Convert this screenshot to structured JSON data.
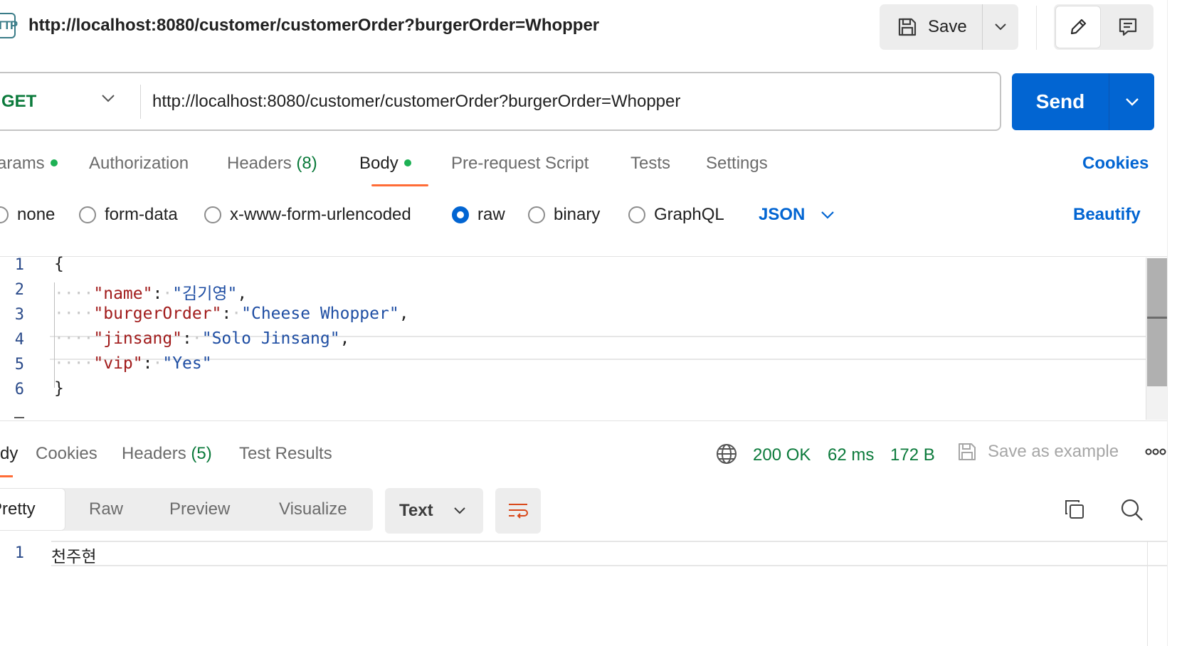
{
  "title_bar": {
    "icon_text": "HTTP",
    "request_title": "http://localhost:8080/customer/customerOrder?burgerOrder=Whopper",
    "save_label": "Save"
  },
  "request": {
    "method": "GET",
    "url": "http://localhost:8080/customer/customerOrder?burgerOrder=Whopper",
    "send_label": "Send"
  },
  "request_tabs": {
    "params": "arams",
    "authorization": "Authorization",
    "headers": "Headers",
    "headers_count": "(8)",
    "body": "Body",
    "prerequest": "Pre-request Script",
    "tests": "Tests",
    "settings": "Settings",
    "cookies": "Cookies"
  },
  "body_types": {
    "none": "none",
    "form_data": "form-data",
    "urlencoded": "x-www-form-urlencoded",
    "raw": "raw",
    "binary": "binary",
    "graphql": "GraphQL",
    "selected": "raw",
    "language": "JSON",
    "beautify": "Beautify"
  },
  "editor": {
    "line_numbers": [
      "1",
      "2",
      "3",
      "4",
      "5",
      "6"
    ],
    "open_brace": "{",
    "close_brace": "}",
    "fields": [
      {
        "key": "\"name\"",
        "value": "\"김기영\"",
        "trail": ","
      },
      {
        "key": "\"burgerOrder\"",
        "value": "\"Cheese Whopper\"",
        "trail": ","
      },
      {
        "key": "\"jinsang\"",
        "value": "\"Solo Jinsang\"",
        "trail": ","
      },
      {
        "key": "\"vip\"",
        "value": "\"Yes\"",
        "trail": ""
      }
    ]
  },
  "response_tabs": {
    "body": "dy",
    "cookies": "Cookies",
    "headers": "Headers",
    "headers_count": "(5)",
    "test_results": "Test Results"
  },
  "response_status": {
    "status": "200 OK",
    "time": "62 ms",
    "size": "172 B",
    "save_example": "Save as example"
  },
  "response_view": {
    "pretty": "Pretty",
    "raw": "Raw",
    "preview": "Preview",
    "visualize": "Visualize",
    "format": "Text"
  },
  "response_body": {
    "line_number": "1",
    "text": "천주현"
  },
  "colors": {
    "accent_blue": "#0265d2",
    "method_green": "#0b7a3b",
    "tab_underline": "#ff6c37",
    "dot_green": "#1db154"
  }
}
